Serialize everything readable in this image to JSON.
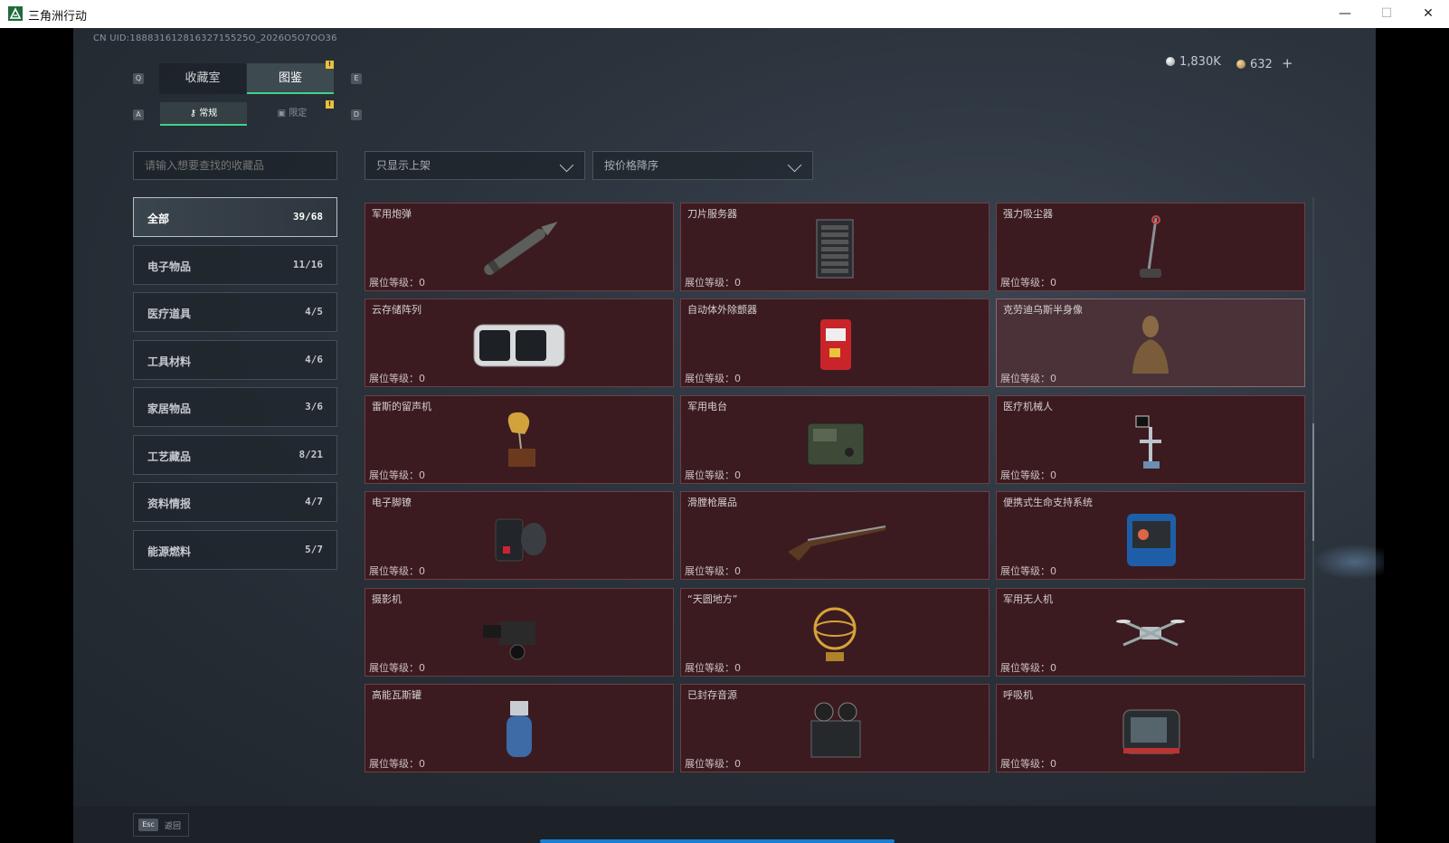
{
  "window": {
    "title": "三角洲行动",
    "min": "—",
    "max": "☐",
    "close": "✕"
  },
  "uid": "CN UID:18883161281632715525O_2026O5O7OO36",
  "currency": {
    "silver": "1,830K",
    "gold": "632",
    "plus": "+"
  },
  "tabs": {
    "q_key": "Q",
    "e_key": "E",
    "collection": "收藏室",
    "catalog": "图鉴",
    "badge": "!"
  },
  "subtabs": {
    "a_key": "A",
    "d_key": "D",
    "regular": "常规",
    "limited": "限定",
    "badge": "!"
  },
  "search": {
    "placeholder": "请输入想要查找的收藏品"
  },
  "filters": {
    "shelf": "只显示上架",
    "sort": "按价格降序"
  },
  "categories": [
    {
      "label": "全部",
      "count": "39/68"
    },
    {
      "label": "电子物品",
      "count": "11/16"
    },
    {
      "label": "医疗道具",
      "count": "4/5"
    },
    {
      "label": "工具材料",
      "count": "4/6"
    },
    {
      "label": "家居物品",
      "count": "3/6"
    },
    {
      "label": "工艺藏品",
      "count": "8/21"
    },
    {
      "label": "资料情报",
      "count": "4/7"
    },
    {
      "label": "能源燃料",
      "count": "5/7"
    }
  ],
  "level_label": "展位等级：",
  "items": [
    {
      "name": "军用炮弹",
      "level": "0",
      "icon": "artillery-shell-icon"
    },
    {
      "name": "刀片服务器",
      "level": "0",
      "icon": "blade-server-icon"
    },
    {
      "name": "强力吸尘器",
      "level": "0",
      "icon": "vacuum-cleaner-icon"
    },
    {
      "name": "云存储阵列",
      "level": "0",
      "icon": "storage-array-icon"
    },
    {
      "name": "自动体外除颤器",
      "level": "0",
      "icon": "defibrillator-icon"
    },
    {
      "name": "克劳迪乌斯半身像",
      "level": "0",
      "icon": "bust-statue-icon"
    },
    {
      "name": "雷斯的留声机",
      "level": "0",
      "icon": "gramophone-icon"
    },
    {
      "name": "军用电台",
      "level": "0",
      "icon": "military-radio-icon"
    },
    {
      "name": "医疗机械人",
      "level": "0",
      "icon": "medical-robot-icon"
    },
    {
      "name": "电子脚镣",
      "level": "0",
      "icon": "ankle-monitor-icon"
    },
    {
      "name": "滑膛枪展品",
      "level": "0",
      "icon": "musket-icon"
    },
    {
      "name": "便携式生命支持系统",
      "level": "0",
      "icon": "life-support-icon"
    },
    {
      "name": "摄影机",
      "level": "0",
      "icon": "video-camera-icon"
    },
    {
      "name": "“天圆地方”",
      "level": "0",
      "icon": "armillary-sphere-icon"
    },
    {
      "name": "军用无人机",
      "level": "0",
      "icon": "drone-icon"
    },
    {
      "name": "高能瓦斯罐",
      "level": "0",
      "icon": "gas-canister-icon"
    },
    {
      "name": "已封存音源",
      "level": "0",
      "icon": "tape-recorder-icon"
    },
    {
      "name": "呼吸机",
      "level": "0",
      "icon": "ventilator-icon"
    }
  ],
  "footer": {
    "esc_key": "Esc",
    "back": "返回"
  }
}
